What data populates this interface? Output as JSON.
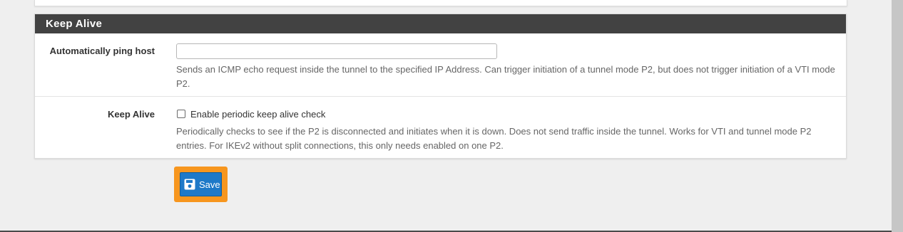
{
  "section": {
    "title": "Keep Alive"
  },
  "ping_host": {
    "label": "Automatically ping host",
    "value": "",
    "placeholder": "",
    "help": "Sends an ICMP echo request inside the tunnel to the specified IP Address. Can trigger initiation of a tunnel mode P2, but does not trigger initiation of a VTI mode P2."
  },
  "keep_alive": {
    "label": "Keep Alive",
    "checkbox_label": "Enable periodic keep alive check",
    "checked": false,
    "help": "Periodically checks to see if the P2 is disconnected and initiates when it is down. Does not send traffic inside the tunnel. Works for VTI and tunnel mode P2 entries. For IKEv2 without split connections, this only needs enabled on one P2."
  },
  "actions": {
    "save_label": "Save",
    "save_icon": "floppy-disk-icon"
  },
  "colors": {
    "heading_bg": "#424242",
    "save_button": "#1e79c8",
    "highlight": "#f7961e"
  }
}
